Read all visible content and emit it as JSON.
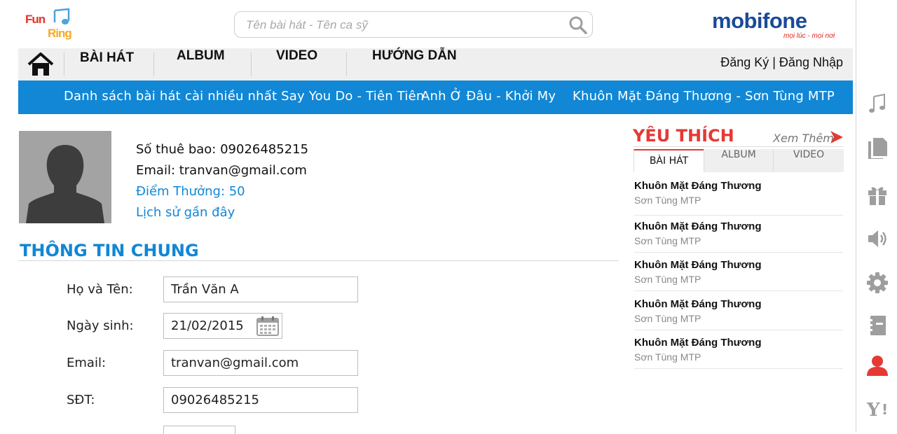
{
  "brand": {
    "logo_line1": "Fun",
    "logo_line2": "Ring",
    "name": "mobifone",
    "tagline": "mọi lúc - mọi nơi"
  },
  "search": {
    "placeholder": "Tên bài hát - Tên ca sỹ",
    "icon": "search-icon"
  },
  "nav": {
    "items": [
      {
        "label": "BÀI HÁT"
      },
      {
        "label": "ALBUM"
      },
      {
        "label": "VIDEO"
      },
      {
        "label": "HƯỚNG DẪN"
      }
    ],
    "auth": "Đăng Ký | Đăng Nhập"
  },
  "marquee": [
    "Danh sách bài hát cài nhiều nhất Say You Do - Tiên Tiên",
    "Anh Ở Đâu - Khởi My",
    "Khuôn Mặt Đáng Thương - Sơn Tùng MTP"
  ],
  "profile": {
    "subscriber": "Số thuê bao: 09026485215",
    "email": "Email: tranvan@gmail.com",
    "points": "Điểm Thưởng: 50",
    "history": "Lịch sử gần đây"
  },
  "section": {
    "title": "THÔNG TIN CHUNG"
  },
  "form": {
    "name_label": "Họ và Tên:",
    "name_value": "Trần Văn A",
    "dob_label": "Ngày sinh:",
    "dob_value": "21/02/2015",
    "email_label": "Email:",
    "email_value": "tranvan@gmail.com",
    "phone_label": "SĐT:",
    "phone_value": "09026485215"
  },
  "favorites": {
    "title": "YÊU THÍCH",
    "more": "Xem Thêm",
    "tabs": [
      {
        "label": "BÀI HÁT"
      },
      {
        "label": "ALBUM"
      },
      {
        "label": "VIDEO"
      }
    ],
    "songs": [
      {
        "title": "Khuôn Mặt Đáng Thương",
        "artist": "Sơn Tùng MTP"
      },
      {
        "title": "Khuôn Mặt Đáng Thương",
        "artist": "Sơn Tùng MTP"
      },
      {
        "title": "Khuôn Mặt Đáng Thương",
        "artist": "Sơn Tùng MTP"
      },
      {
        "title": "Khuôn Mặt Đáng Thương",
        "artist": "Sơn Tùng MTP"
      },
      {
        "title": "Khuôn Mặt Đáng Thương",
        "artist": "Sơn Tùng MTP"
      }
    ]
  },
  "sidebar": {
    "icons": [
      "music-note-icon",
      "documents-icon",
      "gift-icon",
      "speaker-icon",
      "gear-icon",
      "notebook-icon",
      "user-icon",
      "yahoo-icon"
    ]
  },
  "colors": {
    "accent_blue": "#1187d5",
    "accent_red": "#e53935",
    "brand_blue": "#1a4a9a"
  }
}
